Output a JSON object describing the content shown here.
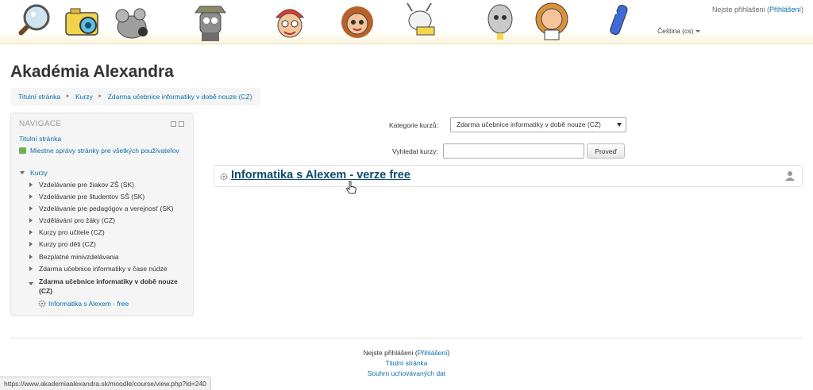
{
  "header": {
    "characters": [
      "magnifier-character",
      "camera-character",
      "mouse-character",
      "detective-character",
      "boy-red-cap-character",
      "girl-character",
      "goat-character",
      "egg-character",
      "teacher-character",
      "pen-character"
    ],
    "login_prefix": "Nejste přihlášeni (",
    "login_link": "Přihlášení",
    "login_suffix": ")",
    "language": "Čeština (cs)"
  },
  "site_title": "Akadémia Alexandra",
  "breadcrumb": [
    "Titulní stránka",
    "Kurzy",
    "Zdarma učebnice informatiky v době nouze (CZ)"
  ],
  "navigation": {
    "title": "NAVIGACE",
    "home": "Titulní stránka",
    "site_news": "Miestne správy stránky pre všetkých používateľov",
    "courses": "Kurzy",
    "categories": [
      "Vzdelávanie pre žiakov ZŠ (SK)",
      "Vzdelávanie pre študentov SŠ (SK)",
      "Vzdelávanie pre pedagógov a verejnosť (SK)",
      "Vzdělávání pro žáky (CZ)",
      "Kurzy pro učitele (CZ)",
      "Kurzy pro děti (CZ)",
      "Bezplatné minivzdelávania",
      "Zdarma učebnice informatiky v čase núdze"
    ],
    "active_category": "Zdarma učebnice informatiky v době nouze (CZ)",
    "active_course": "Informatika s Alexem - free"
  },
  "filters": {
    "category_label": "Kategorie kurzů:",
    "category_selected": "Zdarma učebnice informatiky v době nouze (CZ)",
    "search_label": "Vyhledat kurzy:",
    "search_value": "",
    "search_button": "Proveď"
  },
  "course": {
    "title": "Informatika s Alexem - verze free"
  },
  "footer": {
    "login_prefix": "Nejste přihlášeni (",
    "login_link": "Přihlášení",
    "login_suffix": ")",
    "home": "Titulní stránka",
    "data_retention": "Souhrn uchovávaných dat"
  },
  "status_url": "https://www.akademiaalexandra.sk/moodle/course/view.php?id=240",
  "colors": {
    "link": "#0a6ea8",
    "course_title": "#0d4b6e",
    "header_bg": "#fbf4dc"
  }
}
